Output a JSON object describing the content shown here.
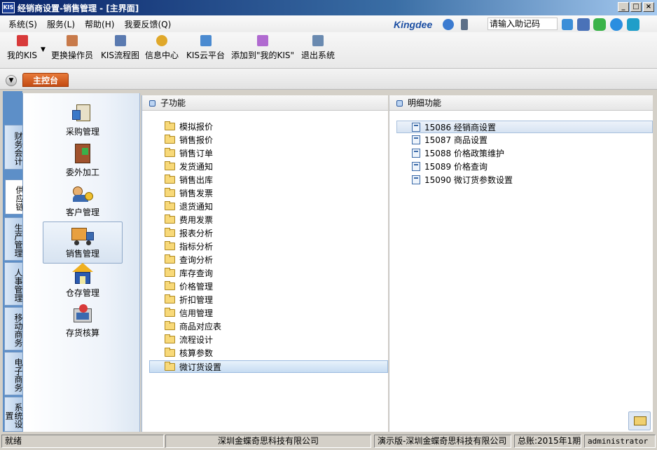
{
  "window": {
    "title": "经销商设置-销售管理 - [主界面]",
    "app_icon": "KIS"
  },
  "menu": {
    "items": [
      "系统(S)",
      "服务(L)",
      "帮助(H)",
      "我要反馈(Q)"
    ]
  },
  "brand": "Kingdee",
  "search": {
    "placeholder": "请输入助记码"
  },
  "toolbar": {
    "buttons": [
      "我的KIS",
      "更换操作员",
      "KIS流程图",
      "信息中心",
      "KIS云平台",
      "添加到\"我的KIS\"",
      "退出系统"
    ]
  },
  "console_tab": "主控台",
  "left_tabs": [
    "财务会计",
    "供应链",
    "生产管理",
    "人事管理",
    "移动商务",
    "电子商务",
    "系统设置"
  ],
  "modules": [
    {
      "label": "采购管理",
      "icon": "purchase-icon"
    },
    {
      "label": "委外加工",
      "icon": "outsource-icon"
    },
    {
      "label": "客户管理",
      "icon": "customer-icon"
    },
    {
      "label": "销售管理",
      "icon": "sales-truck-icon"
    },
    {
      "label": "仓存管理",
      "icon": "warehouse-icon"
    },
    {
      "label": "存货核算",
      "icon": "inventory-calc-icon"
    }
  ],
  "sub_panel": {
    "header": "子功能",
    "folders": [
      "模拟报价",
      "销售报价",
      "销售订单",
      "发货通知",
      "销售出库",
      "销售发票",
      "退货通知",
      "费用发票",
      "报表分析",
      "指标分析",
      "查询分析",
      "库存查询",
      "价格管理",
      "折扣管理",
      "信用管理",
      "商品对应表",
      "流程设计",
      "核算参数",
      "微订货设置"
    ]
  },
  "detail_panel": {
    "header": "明细功能",
    "items": [
      {
        "code": "15086",
        "label": "经销商设置"
      },
      {
        "code": "15087",
        "label": "商品设置"
      },
      {
        "code": "15088",
        "label": "价格政策维护"
      },
      {
        "code": "15089",
        "label": "价格查询"
      },
      {
        "code": "15090",
        "label": "微订货参数设置"
      }
    ]
  },
  "status": {
    "ready": "就绪",
    "company": "深圳金蝶奇思科技有限公司",
    "demo": "演示版-深圳金蝶奇思科技有限公司",
    "account": "总账:2015年1期",
    "user": "administrator"
  },
  "colors": {
    "accent": "#c24a12",
    "title_bar": "#0a246a",
    "selection": "#c6dcf2"
  }
}
